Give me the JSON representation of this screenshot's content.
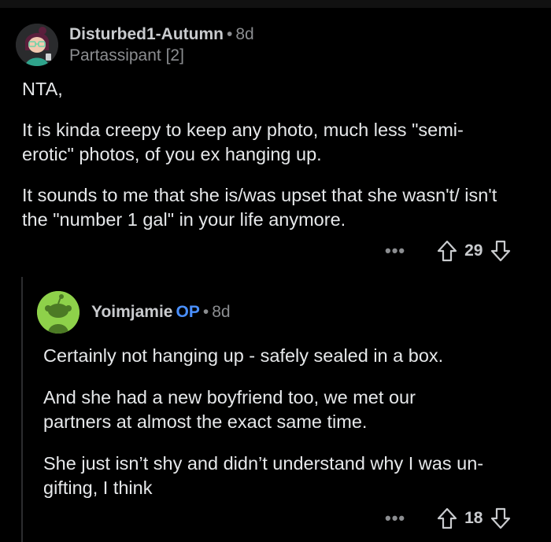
{
  "comment": {
    "author": "Disturbed1-Autumn",
    "separator": "•",
    "age": "8d",
    "flair": "Partassipant [2]",
    "paragraphs": [
      "NTA,",
      "It is kinda creepy to keep any photo, much less \"semi-erotic\" photos, of you ex hanging up.",
      "It sounds to me that she is/was upset that she wasn't/ isn't the \"number 1 gal\" in your life anymore."
    ],
    "more_label": "•••",
    "score": "29"
  },
  "reply": {
    "author": "Yoimjamie",
    "op_badge": "OP",
    "separator": "•",
    "age": "8d",
    "paragraphs": [
      "Certainly not hanging up - safely sealed in a box.",
      "And she had a new boyfriend too, we met our partners at almost the exact same time.",
      "She just isn’t shy and didn’t understand why I was un-gifting, I think"
    ],
    "more_label": "•••",
    "score": "18"
  },
  "colors": {
    "background": "#000000",
    "text": "#e6e8ea",
    "muted": "#8b8d90",
    "op_badge": "#4a90ff",
    "reply_avatar": "#8ed14a"
  }
}
